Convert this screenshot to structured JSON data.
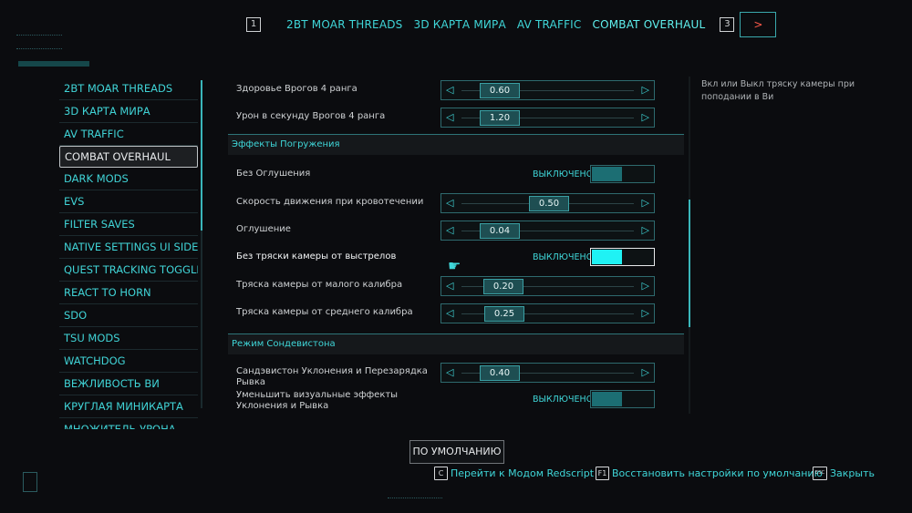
{
  "top_tabs": {
    "key_left": "1",
    "key_right": "3",
    "next_label": ">",
    "items": [
      "2BT MOAR THREADS",
      "3D КАРТА МИРА",
      "AV TRAFFIC",
      "COMBAT OVERHAUL"
    ],
    "active_index": 3
  },
  "mod_list": [
    "2BT MOAR THREADS",
    "3D КАРТА МИРА",
    "AV TRAFFIC",
    "COMBAT OVERHAUL",
    "DARK MODS",
    "EVS",
    "FILTER SAVES",
    "NATIVE SETTINGS UI SIDE",
    "QUEST TRACKING TOGGLE",
    "REACT TO HORN",
    "SDO",
    "TSU MODS",
    "WATCHDOG",
    "ВЕЖЛИВОСТЬ ВИ",
    "КРУГЛАЯ МИНИКАРТА",
    "МНОЖИТЕЛЬ УРОНА"
  ],
  "mod_list_active_index": 3,
  "settings": {
    "row0_label": "Здоровье Врогов 4 ранга",
    "row0_value": "0.60",
    "row1_label": "Урон в секунду Врогов 4 ранга",
    "row1_value": "1.20",
    "section1": "Эффекты Погружения",
    "row2_label": "Без Оглушения",
    "row2_state": "ВЫКЛЮЧЕНО",
    "row3_label": "Скорость движения при кровотечении",
    "row3_value": "0.50",
    "row4_label": "Оглушение",
    "row4_value": "0.04",
    "row5_label": "Без тряски камеры от выстрелов",
    "row5_state": "ВЫКЛЮЧЕНО",
    "row6_label": "Тряска камеры от малого калибра",
    "row6_value": "0.20",
    "row7_label": "Тряска камеры от среднего калибра",
    "row7_value": "0.25",
    "section2": "Режим Сондевистона",
    "row8_label": "Сандэвистон Уклонения и Перезарядка Рывка",
    "row8_value": "0.40",
    "row9_label": "Уменьшить визуальные эффекты Уклонения и Рывка",
    "row9_state": "ВЫКЛЮЧЕНО"
  },
  "description": "Вкл или Выкл тряску камеры при поподании в Ви",
  "default_button": "ПО УМОЛЧАНИЮ",
  "hints": {
    "c_key": "C",
    "c_text": "Перейти к Модом Redscript",
    "f1_key": "F1",
    "f1_text": "Восстановить настройки по умолчанию",
    "esc_key": "ESC",
    "esc_text": "Закрыть"
  },
  "colors": {
    "accent": "#3fd6d8",
    "background": "#0b0c0f",
    "highlight": "#1ff2f4",
    "alert": "#ff5a4a"
  }
}
